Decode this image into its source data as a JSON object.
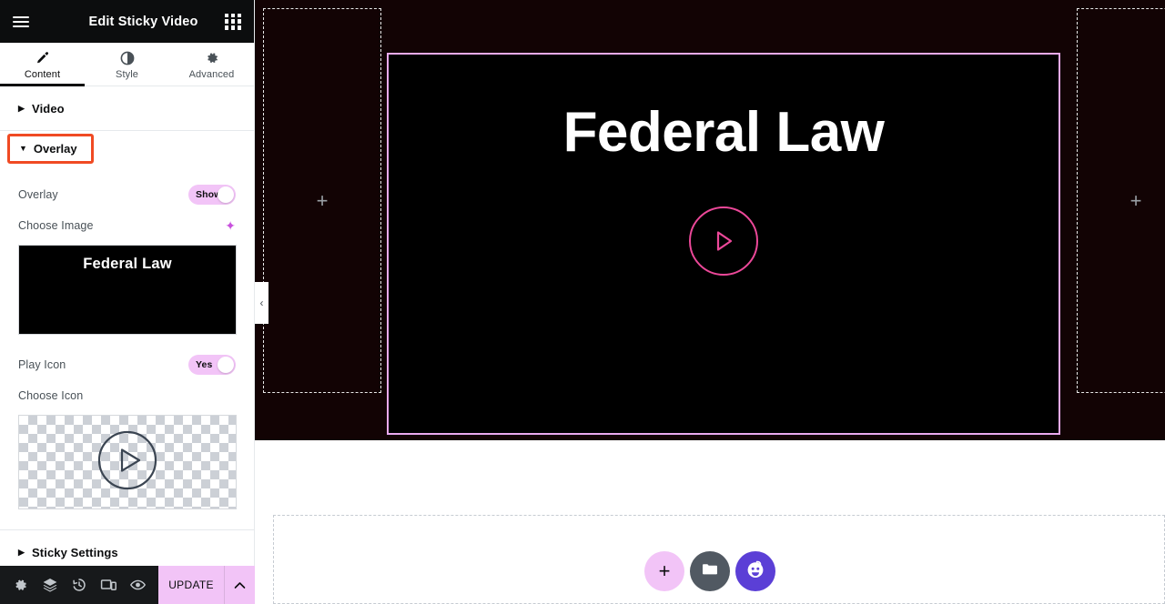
{
  "panel": {
    "header": {
      "title": "Edit Sticky Video",
      "menu_icon": "hamburger-icon",
      "apps_icon": "grid-apps-icon"
    },
    "tabs": [
      {
        "label": "Content",
        "icon": "pencil-icon",
        "active": true
      },
      {
        "label": "Style",
        "icon": "contrast-icon",
        "active": false
      },
      {
        "label": "Advanced",
        "icon": "gear-icon",
        "active": false
      }
    ],
    "sections": [
      {
        "label": "Video",
        "expanded": false,
        "highlighted": false
      },
      {
        "label": "Overlay",
        "expanded": true,
        "highlighted": true
      },
      {
        "label": "Sticky Settings",
        "expanded": false,
        "highlighted": false
      }
    ],
    "controls": {
      "overlay": {
        "label": "Overlay",
        "toggle_value": "Show",
        "state": "on"
      },
      "choose_image": {
        "label": "Choose Image",
        "ai_icon": "sparkle-ai-icon",
        "preview_caption": "Federal Law"
      },
      "play_icon": {
        "label": "Play Icon",
        "toggle_value": "Yes",
        "state": "on"
      },
      "choose_icon": {
        "label": "Choose Icon",
        "preview_icon": "play-circle-icon"
      }
    },
    "footer": {
      "tools": [
        {
          "name": "settings-gear-icon",
          "label": "Settings"
        },
        {
          "name": "layers-navigator-icon",
          "label": "Navigator"
        },
        {
          "name": "history-clock-icon",
          "label": "History"
        },
        {
          "name": "responsive-devices-icon",
          "label": "Responsive Mode"
        },
        {
          "name": "preview-eye-icon",
          "label": "Preview Changes"
        }
      ],
      "update_label": "UPDATE",
      "update_caret_icon": "chevron-up-icon"
    }
  },
  "canvas": {
    "collapse_handle": {
      "icon": "chevron-left-icon"
    },
    "columns": [
      {
        "name": "left-empty-column",
        "add_icon": "plus-icon"
      },
      {
        "name": "right-empty-column",
        "add_icon": "plus-icon"
      }
    ],
    "video_widget": {
      "title": "Federal Law",
      "play_icon": "play-triangle-icon",
      "selected": true
    },
    "fabs": [
      {
        "name": "add-element-button",
        "icon": "plus-icon",
        "color": "#f2c4f7"
      },
      {
        "name": "add-template-button",
        "icon": "folder-icon",
        "color": "#515962"
      },
      {
        "name": "ai-assistant-button",
        "icon": "ai-face-icon",
        "color": "#5b3fd6"
      }
    ]
  },
  "colors": {
    "panel_header_bg": "#0c0d0e",
    "accent_pink": "#f2c4f7",
    "highlight_red": "#f04a23",
    "widget_border": "#eaaaf0",
    "play_pink": "#ec4899",
    "canvas_dark": "#120304"
  }
}
